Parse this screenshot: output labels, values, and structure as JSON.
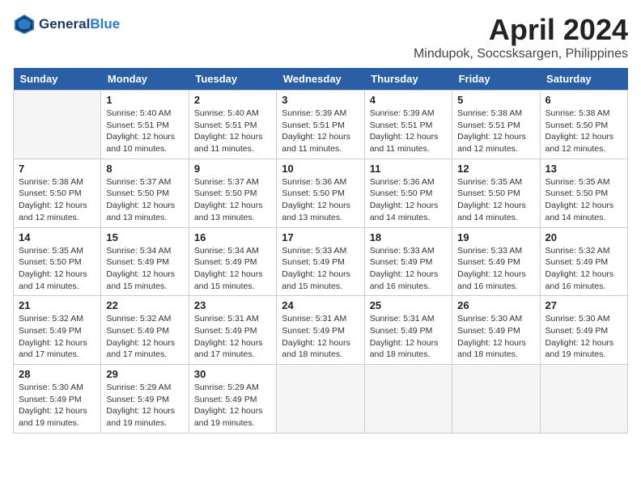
{
  "header": {
    "logo_line1": "General",
    "logo_line2": "Blue",
    "title": "April 2024",
    "location": "Mindupok, Soccsksargen, Philippines"
  },
  "days_of_week": [
    "Sunday",
    "Monday",
    "Tuesday",
    "Wednesday",
    "Thursday",
    "Friday",
    "Saturday"
  ],
  "weeks": [
    [
      {
        "day": "",
        "info": "",
        "empty": true
      },
      {
        "day": "1",
        "info": "Sunrise: 5:40 AM\nSunset: 5:51 PM\nDaylight: 12 hours\nand 10 minutes."
      },
      {
        "day": "2",
        "info": "Sunrise: 5:40 AM\nSunset: 5:51 PM\nDaylight: 12 hours\nand 11 minutes."
      },
      {
        "day": "3",
        "info": "Sunrise: 5:39 AM\nSunset: 5:51 PM\nDaylight: 12 hours\nand 11 minutes."
      },
      {
        "day": "4",
        "info": "Sunrise: 5:39 AM\nSunset: 5:51 PM\nDaylight: 12 hours\nand 11 minutes."
      },
      {
        "day": "5",
        "info": "Sunrise: 5:38 AM\nSunset: 5:51 PM\nDaylight: 12 hours\nand 12 minutes."
      },
      {
        "day": "6",
        "info": "Sunrise: 5:38 AM\nSunset: 5:50 PM\nDaylight: 12 hours\nand 12 minutes."
      }
    ],
    [
      {
        "day": "7",
        "info": "Sunrise: 5:38 AM\nSunset: 5:50 PM\nDaylight: 12 hours\nand 12 minutes."
      },
      {
        "day": "8",
        "info": "Sunrise: 5:37 AM\nSunset: 5:50 PM\nDaylight: 12 hours\nand 13 minutes."
      },
      {
        "day": "9",
        "info": "Sunrise: 5:37 AM\nSunset: 5:50 PM\nDaylight: 12 hours\nand 13 minutes."
      },
      {
        "day": "10",
        "info": "Sunrise: 5:36 AM\nSunset: 5:50 PM\nDaylight: 12 hours\nand 13 minutes."
      },
      {
        "day": "11",
        "info": "Sunrise: 5:36 AM\nSunset: 5:50 PM\nDaylight: 12 hours\nand 14 minutes."
      },
      {
        "day": "12",
        "info": "Sunrise: 5:35 AM\nSunset: 5:50 PM\nDaylight: 12 hours\nand 14 minutes."
      },
      {
        "day": "13",
        "info": "Sunrise: 5:35 AM\nSunset: 5:50 PM\nDaylight: 12 hours\nand 14 minutes."
      }
    ],
    [
      {
        "day": "14",
        "info": "Sunrise: 5:35 AM\nSunset: 5:50 PM\nDaylight: 12 hours\nand 14 minutes."
      },
      {
        "day": "15",
        "info": "Sunrise: 5:34 AM\nSunset: 5:49 PM\nDaylight: 12 hours\nand 15 minutes."
      },
      {
        "day": "16",
        "info": "Sunrise: 5:34 AM\nSunset: 5:49 PM\nDaylight: 12 hours\nand 15 minutes."
      },
      {
        "day": "17",
        "info": "Sunrise: 5:33 AM\nSunset: 5:49 PM\nDaylight: 12 hours\nand 15 minutes."
      },
      {
        "day": "18",
        "info": "Sunrise: 5:33 AM\nSunset: 5:49 PM\nDaylight: 12 hours\nand 16 minutes."
      },
      {
        "day": "19",
        "info": "Sunrise: 5:33 AM\nSunset: 5:49 PM\nDaylight: 12 hours\nand 16 minutes."
      },
      {
        "day": "20",
        "info": "Sunrise: 5:32 AM\nSunset: 5:49 PM\nDaylight: 12 hours\nand 16 minutes."
      }
    ],
    [
      {
        "day": "21",
        "info": "Sunrise: 5:32 AM\nSunset: 5:49 PM\nDaylight: 12 hours\nand 17 minutes."
      },
      {
        "day": "22",
        "info": "Sunrise: 5:32 AM\nSunset: 5:49 PM\nDaylight: 12 hours\nand 17 minutes."
      },
      {
        "day": "23",
        "info": "Sunrise: 5:31 AM\nSunset: 5:49 PM\nDaylight: 12 hours\nand 17 minutes."
      },
      {
        "day": "24",
        "info": "Sunrise: 5:31 AM\nSunset: 5:49 PM\nDaylight: 12 hours\nand 18 minutes."
      },
      {
        "day": "25",
        "info": "Sunrise: 5:31 AM\nSunset: 5:49 PM\nDaylight: 12 hours\nand 18 minutes."
      },
      {
        "day": "26",
        "info": "Sunrise: 5:30 AM\nSunset: 5:49 PM\nDaylight: 12 hours\nand 18 minutes."
      },
      {
        "day": "27",
        "info": "Sunrise: 5:30 AM\nSunset: 5:49 PM\nDaylight: 12 hours\nand 19 minutes."
      }
    ],
    [
      {
        "day": "28",
        "info": "Sunrise: 5:30 AM\nSunset: 5:49 PM\nDaylight: 12 hours\nand 19 minutes."
      },
      {
        "day": "29",
        "info": "Sunrise: 5:29 AM\nSunset: 5:49 PM\nDaylight: 12 hours\nand 19 minutes."
      },
      {
        "day": "30",
        "info": "Sunrise: 5:29 AM\nSunset: 5:49 PM\nDaylight: 12 hours\nand 19 minutes."
      },
      {
        "day": "",
        "info": "",
        "empty": true
      },
      {
        "day": "",
        "info": "",
        "empty": true
      },
      {
        "day": "",
        "info": "",
        "empty": true
      },
      {
        "day": "",
        "info": "",
        "empty": true
      }
    ]
  ]
}
